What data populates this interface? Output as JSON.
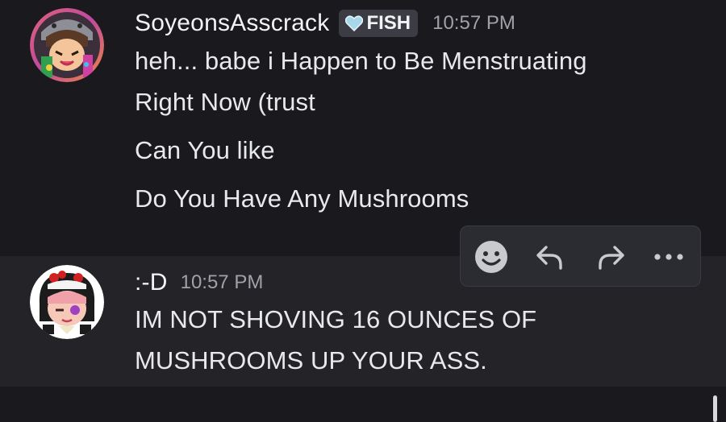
{
  "messages": [
    {
      "username": "SoyeonsAsscrack",
      "tag": "FISH",
      "timestamp": "10:57 PM",
      "lines": [
        "heh... babe i Happen to Be Menstruating",
        "Right Now (trust",
        "Can You like",
        "Do You Have Any Mushrooms"
      ]
    },
    {
      "username": ":-D",
      "timestamp": "10:57 PM",
      "lines": [
        "IM NOT SHOVING 16 OUNCES OF",
        "MUSHROOMS UP YOUR ASS."
      ]
    }
  ],
  "toolbar": {
    "icons": [
      "add-reaction-icon",
      "reply-icon",
      "forward-icon",
      "more-icon"
    ]
  },
  "colors": {
    "background": "#1a1a1e",
    "hover_background": "#232328",
    "text": "#e8e9ec",
    "muted": "#a0a2a8",
    "tag_background": "#3c3d44",
    "toolbar_background": "#2b2c31"
  }
}
